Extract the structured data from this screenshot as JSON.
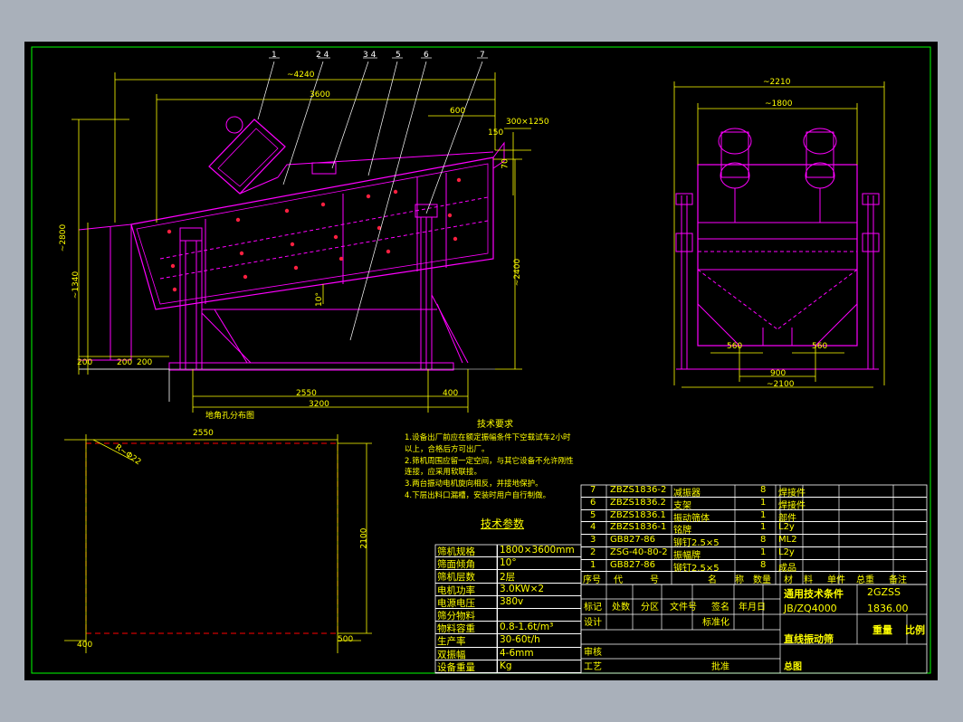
{
  "title_block": {
    "drawing_name": "直线振动筛",
    "model": "2GZSS",
    "standard": "JB/ZQ4000",
    "general_tech": "通用技术条件",
    "weight": "1836.00",
    "weight_label": "重量",
    "scale_label": "比例",
    "assembly_label": "总图",
    "labels": {
      "mark": "标记",
      "count": "处数",
      "zone": "分区",
      "doc": "文件号",
      "sign": "签名",
      "date": "年月日",
      "design": "设计",
      "standardize": "标准化",
      "review": "审核",
      "process": "工艺",
      "approve": "批准"
    }
  },
  "bom": {
    "headers": [
      "序号",
      "代",
      "号",
      "名",
      "称",
      "数量",
      "材",
      "料",
      "单件",
      "总重",
      "备注"
    ],
    "rows": [
      {
        "no": "7",
        "code": "ZBZS1836-2",
        "name": "减振器",
        "qty": "8",
        "material": "焊接件"
      },
      {
        "no": "6",
        "code": "ZBZS1836.2",
        "name": "支架",
        "qty": "1",
        "material": "焊接件"
      },
      {
        "no": "5",
        "code": "ZBZS1836.1",
        "name": "振动筛体",
        "qty": "1",
        "material": "部件"
      },
      {
        "no": "4",
        "code": "ZBZS1836-1",
        "name": "铭牌",
        "qty": "1",
        "material": "L2y"
      },
      {
        "no": "3",
        "code": "GB827-86",
        "name": "铆钉2.5×5",
        "qty": "8",
        "material": "ML2"
      },
      {
        "no": "2",
        "code": "ZSG-40-80-2",
        "name": "振幅牌",
        "qty": "1",
        "material": "L2y"
      },
      {
        "no": "1",
        "code": "GB827-86",
        "name": "铆钉2.5×5",
        "qty": "8",
        "material": "成品"
      }
    ]
  },
  "params": {
    "title": "技术参数",
    "rows": [
      {
        "k": "筛机规格",
        "v": "1800×3600mm"
      },
      {
        "k": "筛面倾角",
        "v": "10°"
      },
      {
        "k": "筛机层数",
        "v": "2层"
      },
      {
        "k": "电机功率",
        "v": "3.0KW×2"
      },
      {
        "k": "电源电压",
        "v": "380v"
      },
      {
        "k": "筛分物料",
        "v": ""
      },
      {
        "k": "物料容重",
        "v": "0.8-1.6t/m³"
      },
      {
        "k": "生产率",
        "v": "30-60t/h"
      },
      {
        "k": "双振幅",
        "v": "4-6mm"
      },
      {
        "k": "设备重量",
        "v": "Kg"
      }
    ]
  },
  "tech_req": {
    "title": "技术要求",
    "lines": [
      "1.设备出厂前应在额定振幅条件下空载试车2小时",
      "以上，合格后方可出厂。",
      "2.筛机周围应留一定空间，与其它设备不允许刚性",
      "连接，应采用软联接。",
      "3.两台振动电机旋向相反，并接地保护。",
      "4.下层出料口漏槽，安装时用户自行制做。"
    ]
  },
  "dims": {
    "main_overall": "~4240",
    "main_screen": "3600",
    "main_600": "600",
    "main_300": "300×1250",
    "main_150": "150",
    "main_70": "70",
    "main_2800": "~2800",
    "main_1340": "~1340",
    "main_2400": "~2400",
    "main_200a": "200",
    "main_200b": "200",
    "main_200c": "200",
    "main_2550": "2550",
    "main_400": "400",
    "main_3200": "3200",
    "main_10": "10°",
    "side_2210": "~2210",
    "side_1800": "~1800",
    "side_560a": "560",
    "side_560b": "560",
    "side_900": "900",
    "side_2100": "~2100",
    "plan_2550": "2550",
    "plan_2100": "2100",
    "plan_400": "400",
    "plan_500": "500",
    "plan_r": "R~Φ22",
    "plan_caption": "地角孔分布图"
  },
  "balloons": [
    "1",
    "2 4",
    "3 4",
    "5",
    "6",
    "7"
  ]
}
